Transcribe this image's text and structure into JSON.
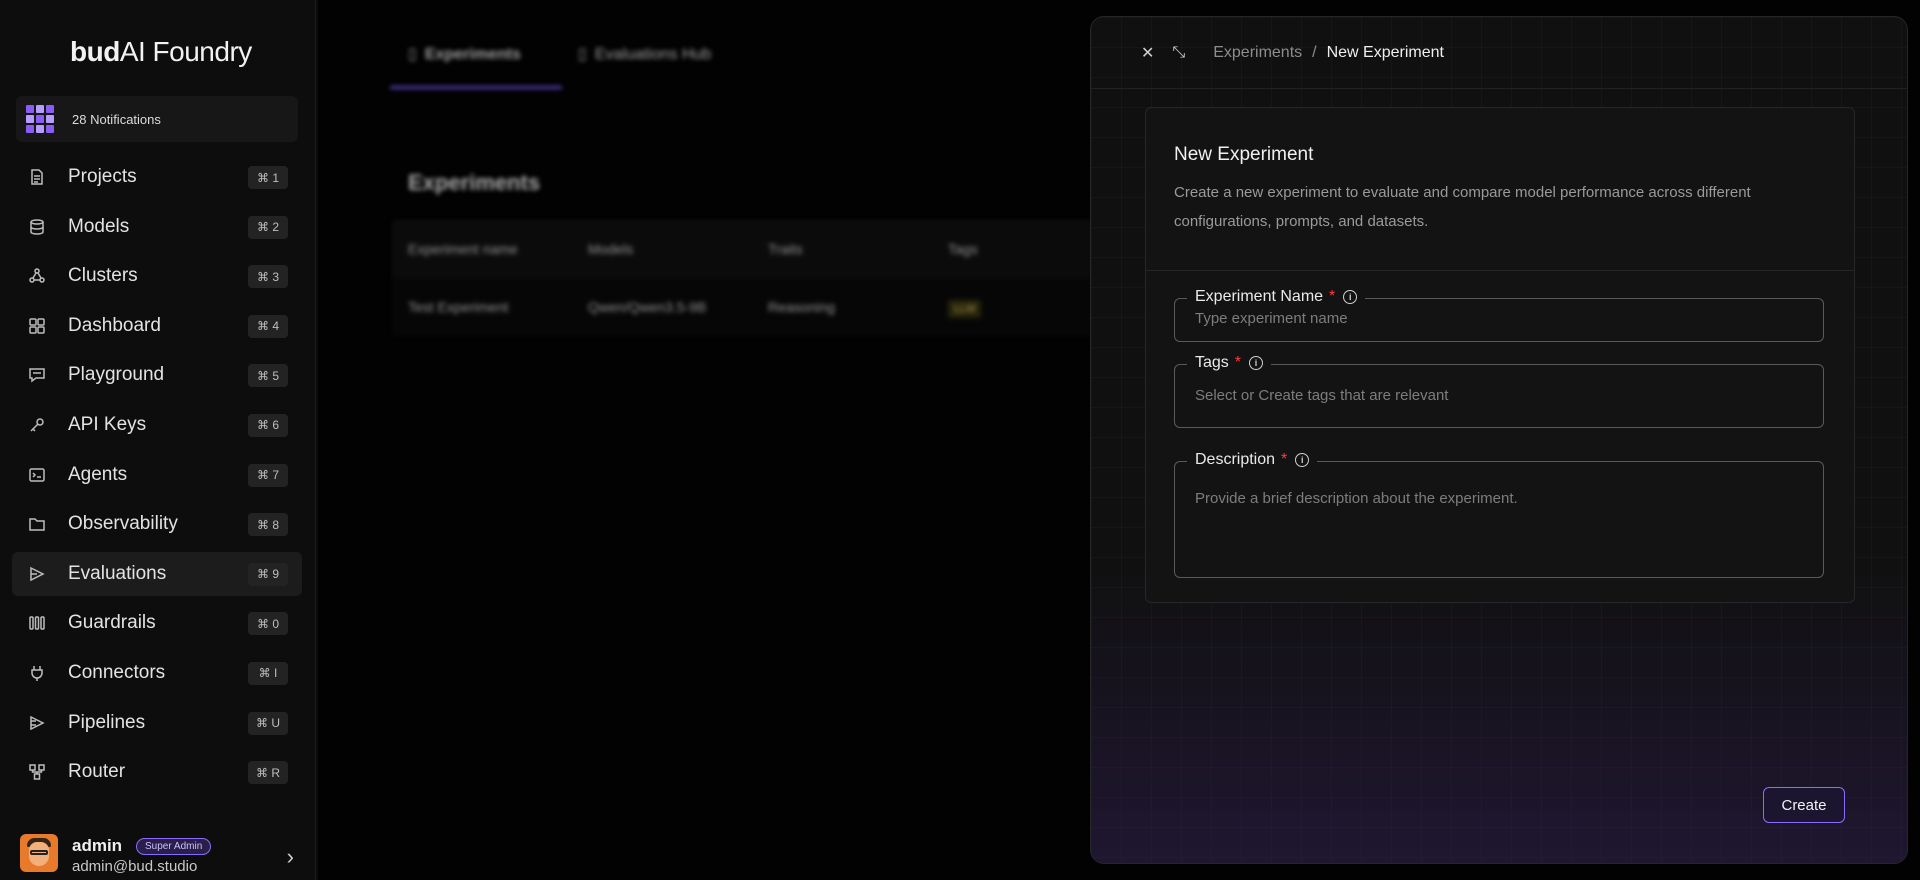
{
  "brand": {
    "logo_bold": "bud",
    "logo_rest": "AI Foundry"
  },
  "notifications": {
    "label": "28 Notifications"
  },
  "sidebar": {
    "items": [
      {
        "label": "Projects",
        "shortcut": "⌘ 1",
        "icon": "file-icon"
      },
      {
        "label": "Models",
        "shortcut": "⌘ 2",
        "icon": "database-icon"
      },
      {
        "label": "Clusters",
        "shortcut": "⌘ 3",
        "icon": "cluster-icon"
      },
      {
        "label": "Dashboard",
        "shortcut": "⌘ 4",
        "icon": "grid-icon"
      },
      {
        "label": "Playground",
        "shortcut": "⌘ 5",
        "icon": "chat-icon"
      },
      {
        "label": "API Keys",
        "shortcut": "⌘ 6",
        "icon": "key-icon"
      },
      {
        "label": "Agents",
        "shortcut": "⌘ 7",
        "icon": "terminal-icon"
      },
      {
        "label": "Observability",
        "shortcut": "⌘ 8",
        "icon": "folder-icon"
      },
      {
        "label": "Evaluations",
        "shortcut": "⌘ 9",
        "icon": "evaluation-icon",
        "active": true
      },
      {
        "label": "Guardrails",
        "shortcut": "⌘ 0",
        "icon": "guardrails-icon"
      },
      {
        "label": "Connectors",
        "shortcut": "⌘ I",
        "icon": "plug-icon"
      },
      {
        "label": "Pipelines",
        "shortcut": "⌘ U",
        "icon": "pipeline-icon"
      },
      {
        "label": "Router",
        "shortcut": "⌘ R",
        "icon": "router-icon"
      }
    ]
  },
  "user": {
    "name": "admin",
    "role": "Super Admin",
    "email": "admin@bud.studio"
  },
  "background": {
    "tabs": [
      "Experiments",
      "Evaluations Hub"
    ],
    "title": "Experiments",
    "table": {
      "headers": [
        "Experiment name",
        "Models",
        "Traits",
        "Tags"
      ],
      "rows": [
        [
          "Test Experiment",
          "Qwen/Qwen3.5-9B",
          "Reasoning",
          "LLM"
        ]
      ]
    }
  },
  "drawer": {
    "breadcrumb": {
      "parent": "Experiments",
      "separator": "/",
      "current": "New Experiment"
    },
    "card": {
      "title": "New Experiment",
      "description": "Create a new experiment to evaluate and compare model performance across different configurations, prompts, and datasets."
    },
    "fields": {
      "name": {
        "label": "Experiment Name",
        "placeholder": "Type experiment name"
      },
      "tags": {
        "label": "Tags",
        "placeholder": "Select or Create tags that are relevant"
      },
      "description": {
        "label": "Description",
        "placeholder": "Provide a brief description about the experiment."
      }
    },
    "required_mark": "*",
    "info_glyph": "i",
    "create_label": "Create"
  },
  "colors": {
    "accent": "#8b6bff",
    "required": "#ff3b3b"
  }
}
